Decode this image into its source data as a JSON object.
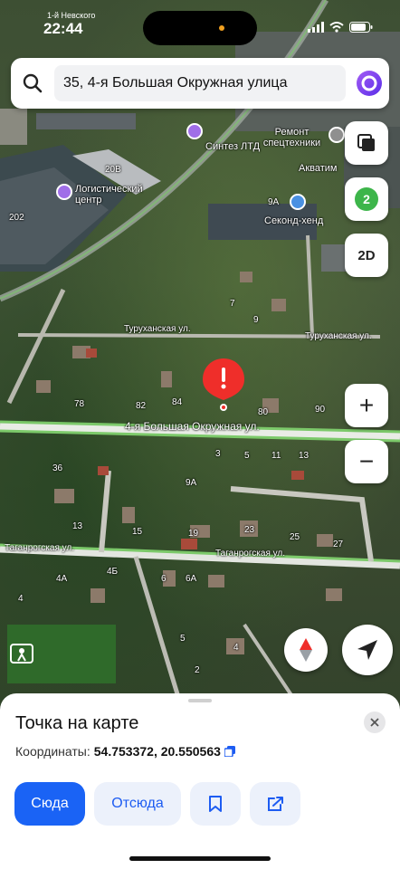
{
  "status_bar": {
    "time": "22:44",
    "subtitle": "1-й Невского",
    "icons": [
      "signal-icon",
      "wifi-icon",
      "battery-icon"
    ]
  },
  "search": {
    "value": "35, 4-я Большая Окружная улица",
    "icons": [
      "search-icon",
      "alice-icon"
    ]
  },
  "map": {
    "pois": [
      {
        "name": "Синтез ЛТД"
      },
      {
        "name": "Логистический центр"
      },
      {
        "name": "Ремонт спецтехники"
      },
      {
        "name": "Акватим"
      },
      {
        "name": "Секонд-хенд"
      }
    ],
    "streets": [
      "Туруханская ул.",
      "Туруханская ул.",
      "4-я Большая Окружная ул.",
      "Таганрогская ул.",
      "Таганрогская ул."
    ],
    "building_labels": [
      "202",
      "20В",
      "9А",
      "80",
      "78",
      "82",
      "84",
      "90",
      "7",
      "9",
      "11",
      "13",
      "5",
      "3",
      "36",
      "9А",
      "13",
      "15",
      "19",
      "23",
      "25",
      "27",
      "4А",
      "4Б",
      "6",
      "6А",
      "4",
      "4",
      "5",
      "2"
    ],
    "accent_color": "#7cc96a"
  },
  "map_controls": {
    "layers_icon": "layers-icon",
    "traffic_level": "2",
    "mode_label": "2D",
    "zoom_in": "+",
    "zoom_out": "−",
    "compass_icon": "compass-icon",
    "locate_icon": "locate-arrow-icon",
    "panorama_icon": "panorama-icon"
  },
  "sheet": {
    "title": "Точка на карте",
    "coords_label": "Координаты:",
    "coords_value": "54.753372, 20.550563",
    "buttons": {
      "to_here": "Сюда",
      "from_here": "Отсюда",
      "bookmark_icon": "bookmark-icon",
      "share_icon": "share-icon"
    },
    "colors": {
      "primary": "#1a63f5",
      "secondary_bg": "#ecf1fb"
    }
  }
}
